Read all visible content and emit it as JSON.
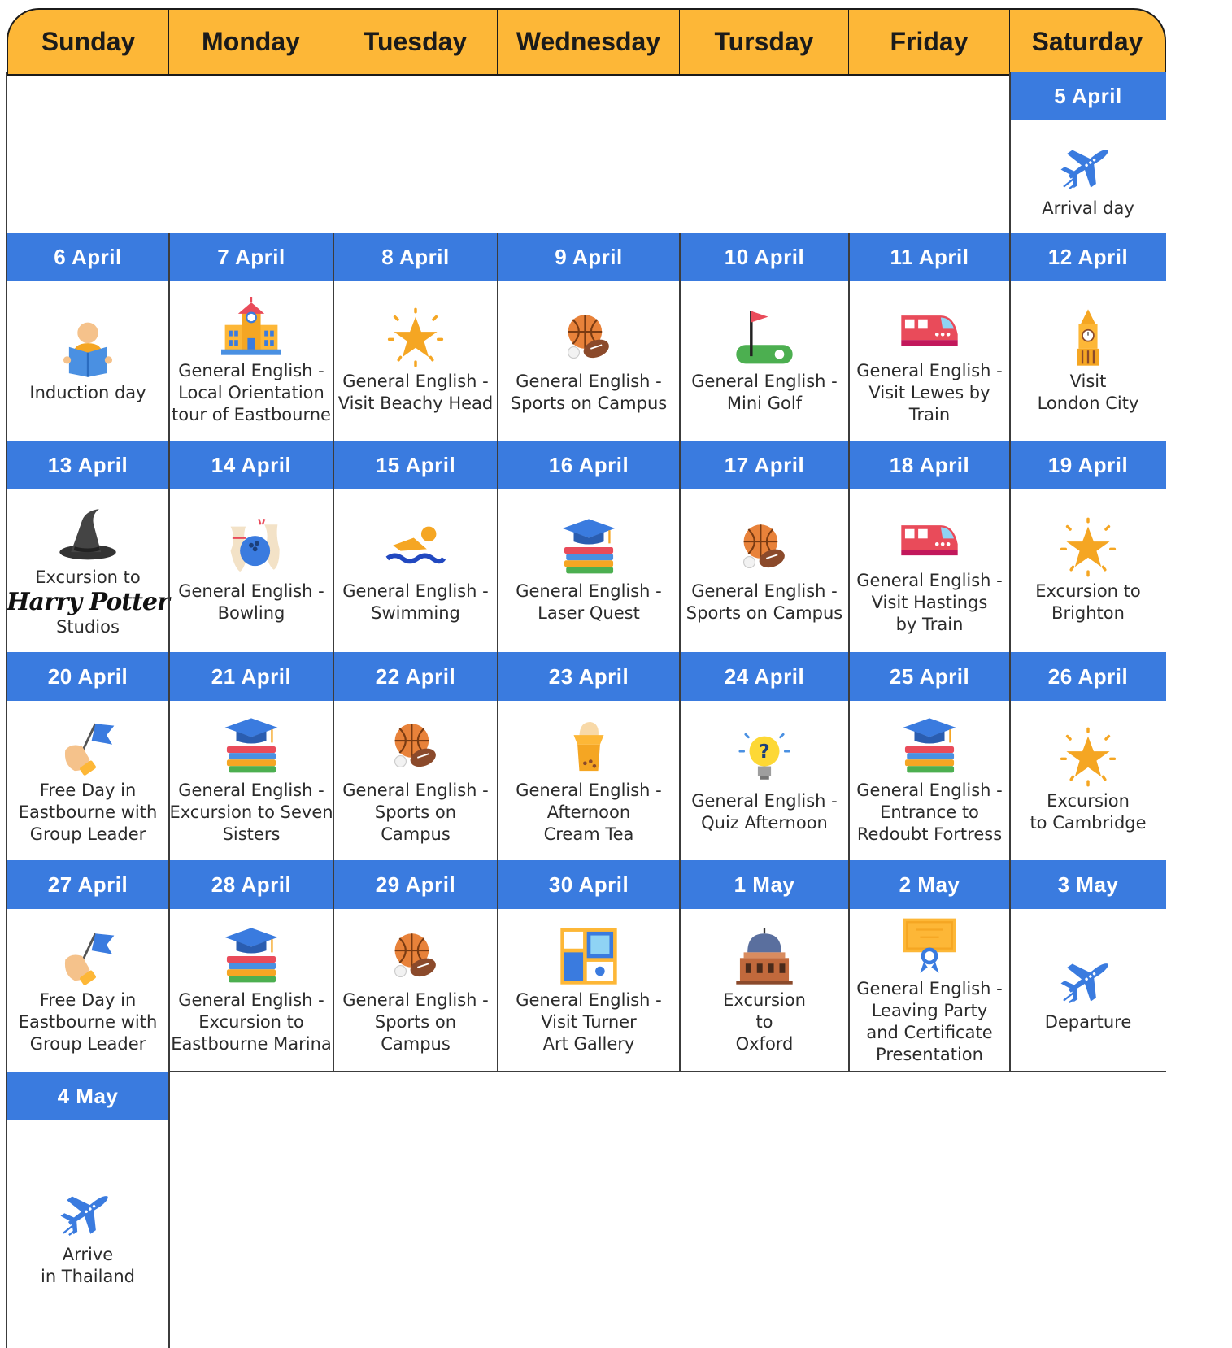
{
  "calendar": {
    "day_headers": [
      "Sunday",
      "Monday",
      "Tuesday",
      "Wednesday",
      "Tursday",
      "Friday",
      "Saturday"
    ],
    "weeks": [
      {
        "dates": [
          "",
          "",
          "",
          "",
          "",
          "",
          "5 April"
        ],
        "activities": [
          null,
          null,
          null,
          null,
          null,
          null,
          {
            "icon": "airplane-icon",
            "text": "Arrival day"
          }
        ]
      },
      {
        "dates": [
          "6 April",
          "7 April",
          "8 April",
          "9 April",
          "10 April",
          "11 April",
          "12 April"
        ],
        "activities": [
          {
            "icon": "reading-person-icon",
            "text": "Induction day"
          },
          {
            "icon": "school-building-icon",
            "text": "General English -\nLocal Orientation\ntour of Eastbourne"
          },
          {
            "icon": "star-icon",
            "text": "General English -\nVisit Beachy Head"
          },
          {
            "icon": "sports-balls-icon",
            "text": "General English -\nSports on Campus"
          },
          {
            "icon": "mini-golf-icon",
            "text": "General English -\nMini Golf"
          },
          {
            "icon": "train-icon",
            "text": "General English -\nVisit Lewes by Train"
          },
          {
            "icon": "big-ben-icon",
            "text": "Visit\nLondon City"
          }
        ]
      },
      {
        "dates": [
          "13 April",
          "14 April",
          "15 April",
          "16 April",
          "17 April",
          "18 April",
          "19 April"
        ],
        "activities": [
          {
            "icon": "wizard-hat-icon",
            "text": "Excursion to",
            "logo": "Harry Potter",
            "text2": "Studios"
          },
          {
            "icon": "bowling-icon",
            "text": "General English -\nBowling"
          },
          {
            "icon": "swimmer-icon",
            "text": "General English -\nSwimming"
          },
          {
            "icon": "graduation-books-icon",
            "text": "General English -\nLaser Quest"
          },
          {
            "icon": "sports-balls-icon",
            "text": "General English -\nSports on Campus"
          },
          {
            "icon": "train-icon",
            "text": "General English -\nVisit Hastings\nby Train"
          },
          {
            "icon": "star-icon",
            "text": "Excursion to\nBrighton"
          }
        ]
      },
      {
        "dates": [
          "20 April",
          "21 April",
          "22 April",
          "23 April",
          "24 April",
          "25 April",
          "26 April"
        ],
        "activities": [
          {
            "icon": "hand-flag-icon",
            "text": "Free Day in\nEastbourne with\nGroup Leader"
          },
          {
            "icon": "graduation-books-icon",
            "text": "General English -\nExcursion to Seven\nSisters"
          },
          {
            "icon": "sports-balls-icon",
            "text": "General English -\nSports on\nCampus"
          },
          {
            "icon": "cream-tea-cup-icon",
            "text": "General English -\nAfternoon\nCream Tea"
          },
          {
            "icon": "lightbulb-question-icon",
            "text": "General English -\nQuiz Afternoon"
          },
          {
            "icon": "graduation-books-icon",
            "text": "General English -\nEntrance to\nRedoubt Fortress"
          },
          {
            "icon": "star-icon",
            "text": "Excursion\nto  Cambridge"
          }
        ]
      },
      {
        "dates": [
          "27 April",
          "28 April",
          "29 April",
          "30 April",
          "1 May",
          "2 May",
          "3 May"
        ],
        "activities": [
          {
            "icon": "hand-flag-icon",
            "text": "Free Day in\nEastbourne with\nGroup Leader"
          },
          {
            "icon": "graduation-books-icon",
            "text": "General English -\nExcursion to\nEastbourne Marina"
          },
          {
            "icon": "sports-balls-icon",
            "text": "General English -\nSports on\nCampus"
          },
          {
            "icon": "art-gallery-icon",
            "text": "General English -\nVisit Turner\nArt Gallery"
          },
          {
            "icon": "domed-building-icon",
            "text": "Excursion\nto\nOxford"
          },
          {
            "icon": "certificate-icon",
            "text": "General English -\nLeaving Party\nand Certificate\nPresentation"
          },
          {
            "icon": "airplane-icon",
            "text": "Departure"
          }
        ]
      },
      {
        "dates": [
          "4 May",
          "",
          "",
          "",
          "",
          "",
          ""
        ],
        "activities": [
          {
            "icon": "airplane-icon",
            "text": "Arrive\nin Thailand"
          },
          null,
          null,
          null,
          null,
          null,
          null
        ]
      }
    ]
  },
  "colors": {
    "header_bg": "#FDB737",
    "date_bar": "#3A7BDF",
    "grid": "#3c3c3c"
  }
}
